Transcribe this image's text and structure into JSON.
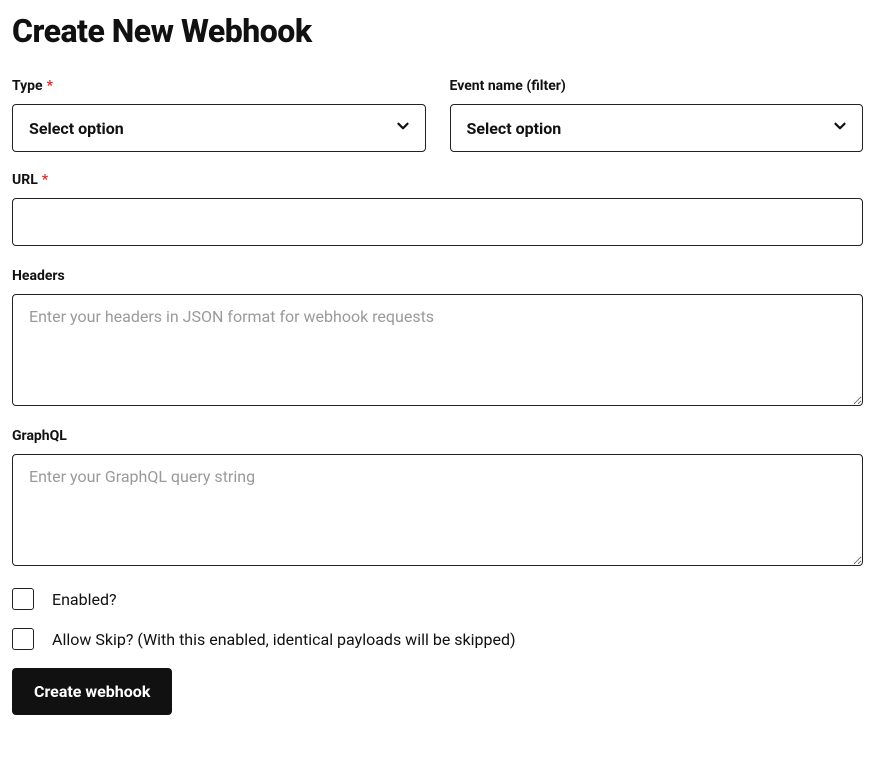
{
  "page": {
    "title": "Create New Webhook"
  },
  "fields": {
    "type": {
      "label": "Type",
      "required_mark": "*",
      "selected": "Select option"
    },
    "eventName": {
      "label": "Event name (filter)",
      "selected": "Select option"
    },
    "url": {
      "label": "URL",
      "required_mark": "*",
      "value": ""
    },
    "headers": {
      "label": "Headers",
      "placeholder": "Enter your headers in JSON format for webhook requests",
      "value": ""
    },
    "graphql": {
      "label": "GraphQL",
      "placeholder": "Enter your GraphQL query string",
      "value": ""
    },
    "enabled": {
      "label": "Enabled?",
      "checked": false
    },
    "allowSkip": {
      "label": "Allow Skip? (With this enabled, identical payloads will be skipped)",
      "checked": false
    }
  },
  "actions": {
    "submit": "Create webhook"
  }
}
